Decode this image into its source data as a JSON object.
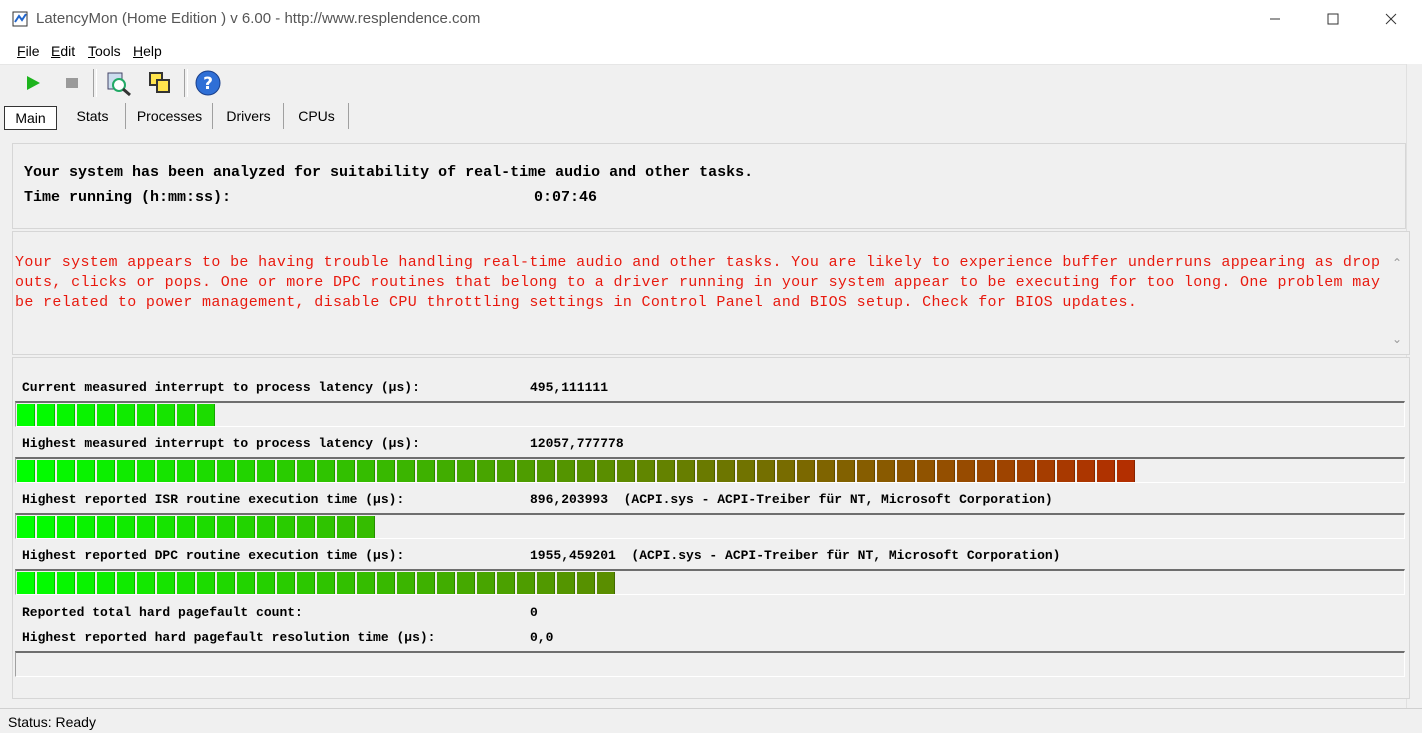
{
  "window": {
    "title": "LatencyMon  (Home Edition )  v 6.00 - http://www.resplendence.com"
  },
  "menu": [
    "File",
    "Edit",
    "Tools",
    "Help"
  ],
  "toolbar": {
    "icons": [
      "play-icon",
      "stop-icon",
      "report-icon",
      "windows-icon",
      "help-icon"
    ]
  },
  "tabs": [
    "Main",
    "Stats",
    "Processes",
    "Drivers",
    "CPUs"
  ],
  "analysis": {
    "line1": "Your system has been analyzed for suitability of real-time audio and other tasks.",
    "time_label": "Time running (h:mm:ss):",
    "time_value": "0:07:46"
  },
  "warning": {
    "text": "Your system appears to be having trouble handling real-time audio and other tasks. You are likely to experience buffer underruns appearing as drop outs, clicks or pops. One or more DPC routines that belong to a driver running in your system appear to be executing for too long. One problem may be related to power management, disable CPU throttling settings in Control Panel and BIOS setup. Check for BIOS updates.",
    "color": "#e8190e"
  },
  "metrics": [
    {
      "label": "Current measured interrupt to process latency (µs):",
      "value": "495,111111",
      "bar_fraction": 0.142
    },
    {
      "label": "Highest measured interrupt to process latency (µs):",
      "value": "12057,777778",
      "bar_fraction": 0.805
    },
    {
      "label": "Highest reported ISR routine execution time (µs):",
      "value": "896,203993  (ACPI.sys - ACPI-Treiber für NT, Microsoft Corporation)",
      "bar_fraction": 0.258
    },
    {
      "label": "Highest reported DPC routine execution time (µs):",
      "value": "1955,459201  (ACPI.sys - ACPI-Treiber für NT, Microsoft Corporation)",
      "bar_fraction": 0.43
    },
    {
      "label": "Reported total hard pagefault count:",
      "value": "0"
    },
    {
      "label": "Highest reported hard pagefault resolution time (µs):",
      "value": "0,0",
      "bar_fraction": 0
    }
  ],
  "gradient": {
    "low": "#00ff00",
    "mid": "#6a7a00",
    "high": "#e00000"
  },
  "status": {
    "text": "Status: Ready"
  }
}
